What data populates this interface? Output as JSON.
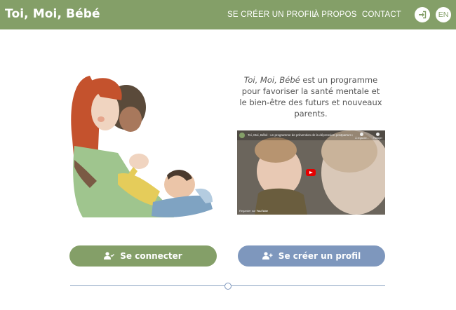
{
  "header": {
    "brand": "Toi, Moi, Bébé",
    "nav": [
      {
        "label": "SE CRÉER UN PROFIL"
      },
      {
        "label": "À PROPOS"
      },
      {
        "label": "CONTACT"
      }
    ],
    "lang_label": "EN",
    "login_icon": "sign-in-icon"
  },
  "intro": {
    "brand_italic": "Toi, Moi, Bébé",
    "text": " est un programme pour favoriser la santé mentale et le bien-être des futurs et nouveaux parents."
  },
  "video": {
    "title": "Toi, Moi, Bébé : un programme de prévention de la dépression postpartum (version longue)",
    "later_label": "À regarder...",
    "share_label": "Partager",
    "watch_on": "Regarder sur",
    "youtube": "YouTube"
  },
  "actions": {
    "login_label": "Se connecter",
    "signup_label": "Se créer un profil"
  },
  "colors": {
    "primary_green": "#849f68",
    "accent_blue": "#7e97bd"
  }
}
